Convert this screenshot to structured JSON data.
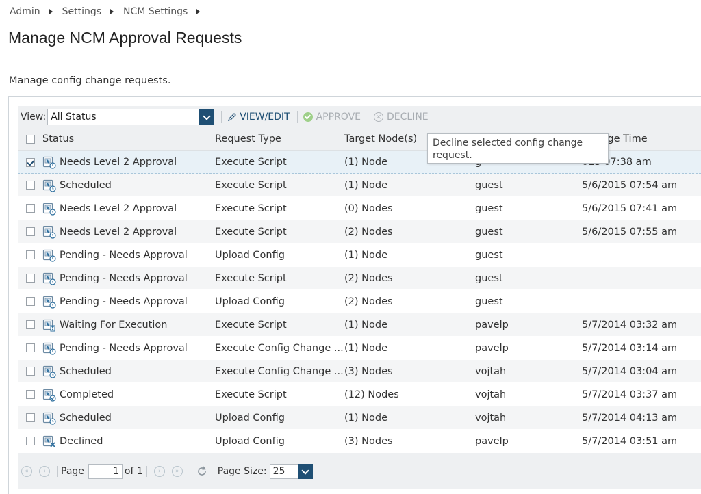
{
  "breadcrumb": [
    "Admin",
    "Settings",
    "NCM Settings"
  ],
  "page_title": "Manage NCM Approval Requests",
  "page_description": "Manage config change requests.",
  "toolbar": {
    "view_label": "View:",
    "view_value": "All Status",
    "view_edit_label": "VIEW/EDIT",
    "approve_label": "APPROVE",
    "decline_label": "DECLINE"
  },
  "columns": {
    "status": "Status",
    "request_type": "Request Type",
    "target_nodes": "Target Node(s)",
    "change_time": "Change Time"
  },
  "tooltip": "Decline selected config change request.",
  "rows": [
    {
      "status": "Needs Level 2 Approval",
      "type": "Execute Script",
      "target": "(1) Node",
      "user": "g",
      "time": "015 07:38 am",
      "checked": true,
      "icon": "approval-request-icon"
    },
    {
      "status": "Scheduled",
      "type": "Execute Script",
      "target": "(1) Node",
      "user": "guest",
      "time": "5/6/2015 07:54 am",
      "checked": false,
      "icon": "scheduled-request-icon"
    },
    {
      "status": "Needs Level 2 Approval",
      "type": "Execute Script",
      "target": "(0) Nodes",
      "user": "guest",
      "time": "5/6/2015 07:41 am",
      "checked": false,
      "icon": "approval-request-icon"
    },
    {
      "status": "Needs Level 2 Approval",
      "type": "Execute Script",
      "target": "(2) Nodes",
      "user": "guest",
      "time": "5/6/2015 07:55 am",
      "checked": false,
      "icon": "approval-request-icon"
    },
    {
      "status": "Pending - Needs Approval",
      "type": "Upload Config",
      "target": "(1) Node",
      "user": "guest",
      "time": "",
      "checked": false,
      "icon": "approval-request-icon"
    },
    {
      "status": "Pending - Needs Approval",
      "type": "Execute Script",
      "target": "(2) Nodes",
      "user": "guest",
      "time": "",
      "checked": false,
      "icon": "approval-request-icon"
    },
    {
      "status": "Pending - Needs Approval",
      "type": "Upload Config",
      "target": "(2) Nodes",
      "user": "guest",
      "time": "",
      "checked": false,
      "icon": "approval-request-icon"
    },
    {
      "status": "Waiting For Execution",
      "type": "Execute Script",
      "target": "(1) Node",
      "user": "pavelp",
      "time": "5/7/2014 03:32 am",
      "checked": false,
      "icon": "waiting-request-icon"
    },
    {
      "status": "Pending - Needs Approval",
      "type": "Execute Config Change ...",
      "target": "(1) Node",
      "user": "pavelp",
      "time": "5/7/2014 03:14 am",
      "checked": false,
      "icon": "approval-request-icon"
    },
    {
      "status": "Scheduled",
      "type": "Execute Config Change ...",
      "target": "(3) Nodes",
      "user": "vojtah",
      "time": "5/7/2014 03:04 am",
      "checked": false,
      "icon": "scheduled-request-icon"
    },
    {
      "status": "Completed",
      "type": "Execute Script",
      "target": "(12) Nodes",
      "user": "vojtah",
      "time": "5/7/2014 03:37 am",
      "checked": false,
      "icon": "completed-request-icon"
    },
    {
      "status": "Scheduled",
      "type": "Upload Config",
      "target": "(1) Node",
      "user": "vojtah",
      "time": "5/7/2014 04:13 am",
      "checked": false,
      "icon": "scheduled-request-icon"
    },
    {
      "status": "Declined",
      "type": "Upload Config",
      "target": "(3) Nodes",
      "user": "pavelp",
      "time": "5/7/2014 03:51 am",
      "checked": false,
      "icon": "declined-request-icon"
    }
  ],
  "pager": {
    "page_label": "Page",
    "page_value": "1",
    "of_label": "of 1",
    "page_size_label": "Page Size:",
    "page_size_value": "25"
  }
}
